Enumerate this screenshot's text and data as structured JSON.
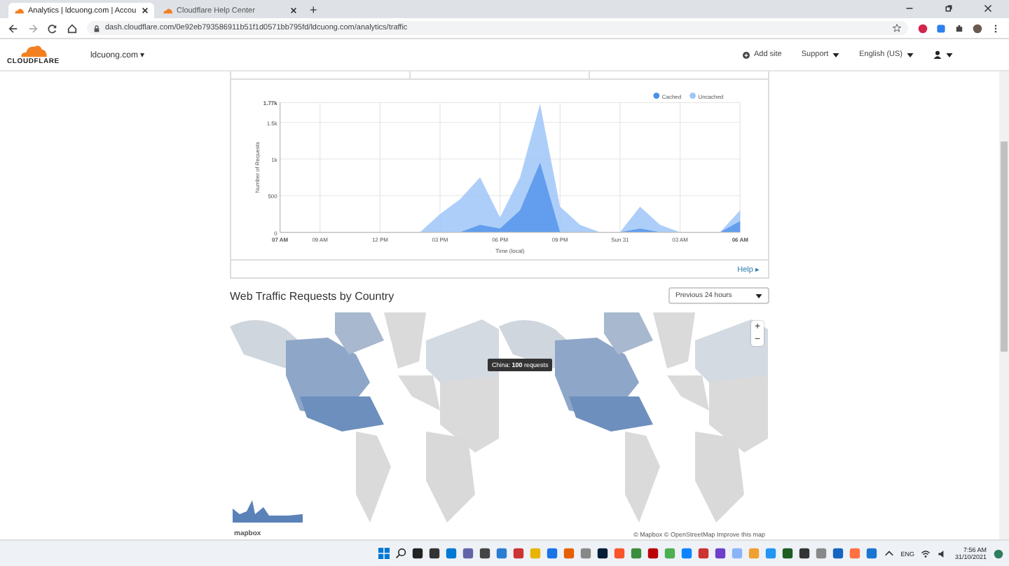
{
  "browser": {
    "tabs": [
      {
        "title": "Analytics | ldcuong.com | Accou",
        "selected": true
      },
      {
        "title": "Cloudflare Help Center",
        "selected": false
      }
    ],
    "new_tab": "+",
    "url": "dash.cloudflare.com/0e92eb793586911b51f1d0571bb795fd/ldcuong.com/analytics/traffic"
  },
  "header": {
    "logo": "CLOUDFLARE",
    "site": "ldcuong.com ▾",
    "menu": [
      "Add site",
      "Support",
      "English (US)"
    ]
  },
  "traffic_chart": {
    "chart_data": {
      "type": "area",
      "xlabel": "Time (local)",
      "ylabel": "Number of Requests",
      "categories": [
        "07 AM",
        null,
        "09 AM",
        null,
        null,
        "12 PM",
        null,
        null,
        "03 PM",
        null,
        null,
        "06 PM",
        null,
        null,
        "09 PM",
        null,
        null,
        "Sun 31",
        null,
        null,
        "03 AM",
        null,
        null,
        "06 AM"
      ],
      "yticks": [
        0,
        {
          "value": 500,
          "label": "500"
        },
        {
          "value": 1000,
          "label": "1k"
        },
        {
          "value": 1500,
          "label": "1.5k"
        },
        {
          "value": 1770,
          "label": "1.77k"
        }
      ],
      "ylim": [
        0,
        1770
      ],
      "stacked": false,
      "grid": true,
      "legend": "top-right",
      "series": [
        {
          "name": "Cached",
          "color": "#4a8ee8",
          "values": [
            0,
            0,
            0,
            0,
            0,
            0,
            0,
            0,
            0,
            0,
            100,
            50,
            300,
            950,
            0,
            0,
            0,
            0,
            50,
            0,
            0,
            0,
            0,
            150
          ]
        },
        {
          "name": "Uncached",
          "color": "#9fc5f8",
          "values": [
            0,
            0,
            0,
            0,
            0,
            0,
            0,
            0,
            250,
            450,
            750,
            200,
            750,
            1750,
            350,
            100,
            0,
            0,
            350,
            100,
            0,
            0,
            0,
            300
          ]
        }
      ]
    },
    "help": "Help ▸"
  },
  "country_section": {
    "title": "Web Traffic Requests by Country",
    "range_select": "Previous 24 hours",
    "zoom_in": "+",
    "zoom_out": "−",
    "tooltip": "China: **100** requests",
    "mapbox_logo": "mapbox",
    "attribution": "© Mapbox © OpenStreetMap Improve this map"
  },
  "taskbar": {
    "language": "ENG",
    "time": "7:56 AM",
    "date": "31/10/2021"
  }
}
